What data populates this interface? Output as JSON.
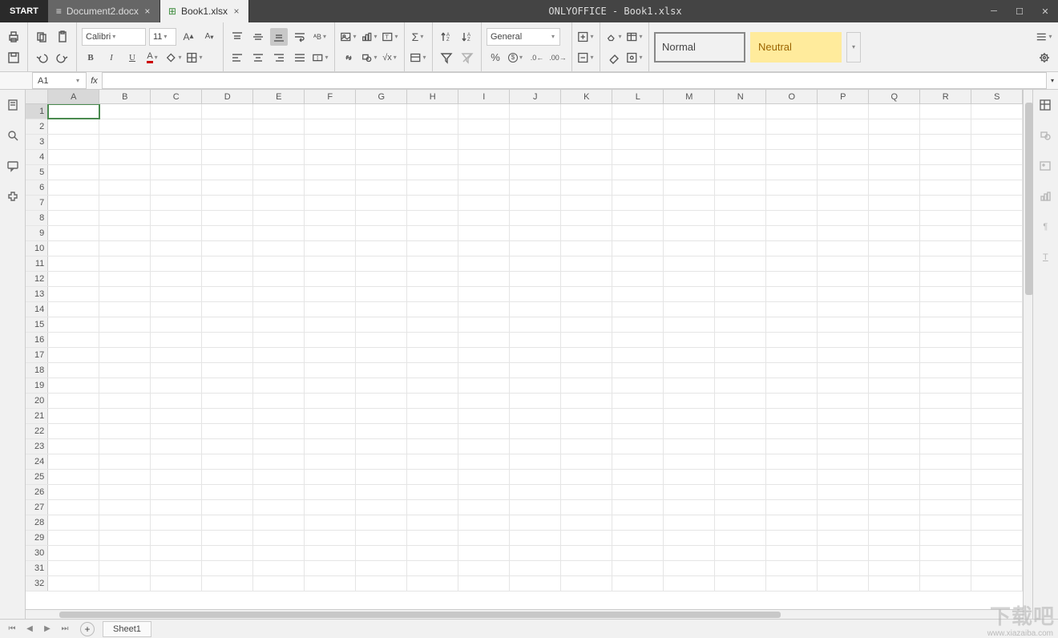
{
  "window": {
    "title": "ONLYOFFICE - Book1.xlsx",
    "start": "START",
    "tabs": [
      {
        "label": "Document2.docx",
        "active": false
      },
      {
        "label": "Book1.xlsx",
        "active": true
      }
    ]
  },
  "toolbar": {
    "font": "Calibri",
    "font_size": "11",
    "number_format": "General",
    "styles": {
      "normal": "Normal",
      "neutral": "Neutral"
    }
  },
  "formula": {
    "namebox": "A1",
    "fx": "fx",
    "value": ""
  },
  "grid": {
    "columns": [
      "A",
      "B",
      "C",
      "D",
      "E",
      "F",
      "G",
      "H",
      "I",
      "J",
      "K",
      "L",
      "M",
      "N",
      "O",
      "P",
      "Q",
      "R",
      "S"
    ],
    "row_count": 32,
    "selected_col": "A",
    "selected_row": 1
  },
  "sheet": {
    "name": "Sheet1"
  },
  "watermark": {
    "text": "下载吧",
    "sub": "www.xiazaiba.com"
  }
}
